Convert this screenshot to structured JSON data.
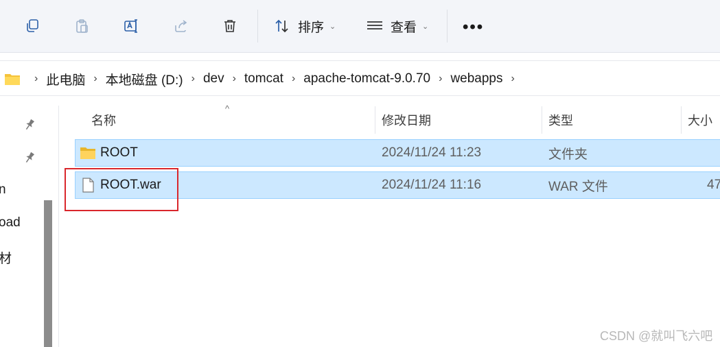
{
  "toolbar": {
    "sort_label": "排序",
    "view_label": "查看",
    "more_label": "•••"
  },
  "breadcrumb": {
    "items": [
      "此电脑",
      "本地磁盘 (D:)",
      "dev",
      "tomcat",
      "apache-tomcat-9.0.70",
      "webapps"
    ],
    "separator": "›"
  },
  "left_pane": {
    "partial_items": [
      "n",
      "oad",
      "材"
    ]
  },
  "columns": {
    "name": "名称",
    "modified": "修改日期",
    "type": "类型",
    "size": "大小"
  },
  "files": [
    {
      "name": "ROOT",
      "modified": "2024/11/24 11:23",
      "type": "文件夹",
      "size": "",
      "icon": "folder-icon"
    },
    {
      "name": "ROOT.war",
      "modified": "2024/11/24 11:16",
      "type": "WAR 文件",
      "size": "47",
      "icon": "file-icon"
    }
  ],
  "watermark": "CSDN @就叫飞六吧",
  "colors": {
    "selection_bg": "#cce8ff",
    "selection_border": "#99d1ff",
    "highlight_red": "#d9262b",
    "folder_yellow": "#f5c33b"
  }
}
